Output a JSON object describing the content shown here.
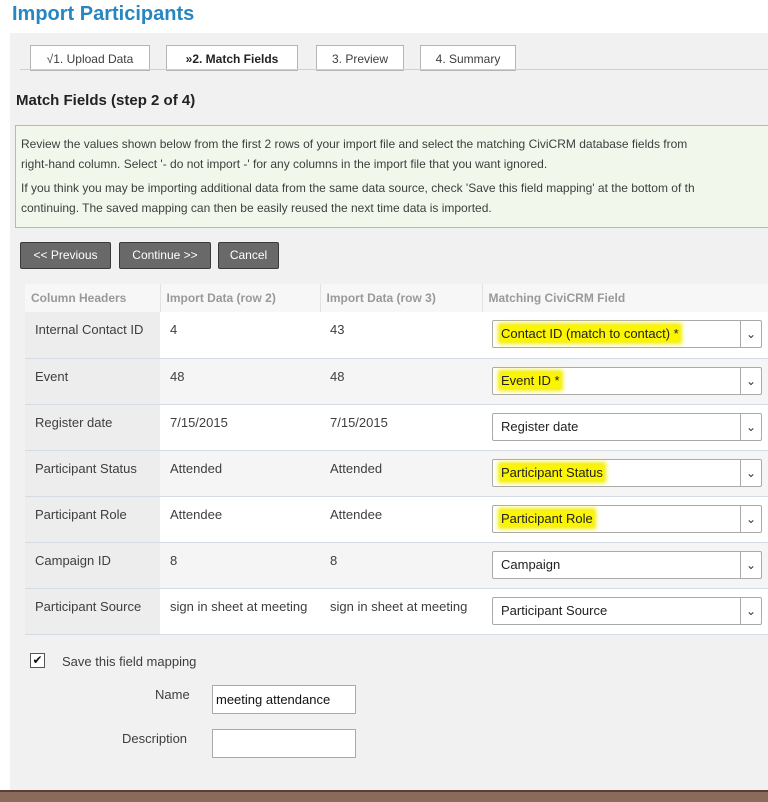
{
  "page_title": "Import Participants",
  "wizard": {
    "steps": [
      {
        "label": "√1. Upload Data"
      },
      {
        "label": "»2. Match Fields"
      },
      {
        "label": "3. Preview"
      },
      {
        "label": "4. Summary"
      }
    ],
    "active_index": 1
  },
  "section_title": "Match Fields (step 2 of 4)",
  "help": {
    "line1": "Review the values shown below from the first 2 rows of your import file and select the matching CiviCRM database fields from",
    "line2": "right-hand column. Select '- do not import -' for any columns in the import file that you want ignored.",
    "line3": "If you think you may be importing additional data from the same data source, check 'Save this field mapping' at the bottom of th",
    "line4": "continuing. The saved mapping can then be easily reused the next time data is imported."
  },
  "buttons": {
    "previous": "<< Previous",
    "continue": "Continue >>",
    "cancel": "Cancel"
  },
  "table": {
    "headers": [
      "Column Headers",
      "Import Data (row 2)",
      "Import Data (row 3)",
      "Matching CiviCRM Field"
    ],
    "rows": [
      {
        "header": "Internal Contact ID",
        "row2": "4",
        "row3": "43",
        "field": "Contact ID (match to contact) *"
      },
      {
        "header": "Event",
        "row2": "48",
        "row3": "48",
        "field": "Event ID *"
      },
      {
        "header": "Register date",
        "row2": "7/15/2015",
        "row3": "7/15/2015",
        "field": "Register date"
      },
      {
        "header": "Participant Status",
        "row2": "Attended",
        "row3": "Attended",
        "field": "Participant Status"
      },
      {
        "header": "Participant Role",
        "row2": "Attendee",
        "row3": "Attendee",
        "field": "Participant Role"
      },
      {
        "header": "Campaign ID",
        "row2": "8",
        "row3": "8",
        "field": "Campaign"
      },
      {
        "header": "Participant Source",
        "row2": "sign in sheet at meeting",
        "row3": "sign in sheet at meeting",
        "field": "Participant Source"
      }
    ]
  },
  "save_mapping": {
    "checked": true,
    "label": "Save this field mapping",
    "name_label": "Name",
    "name_value": "meeting attendance",
    "description_label": "Description",
    "description_value": ""
  },
  "colors": {
    "title": "#2786c2",
    "highlight": "#fbf500",
    "button_bg": "#696969",
    "help_border": "#b0d730"
  }
}
